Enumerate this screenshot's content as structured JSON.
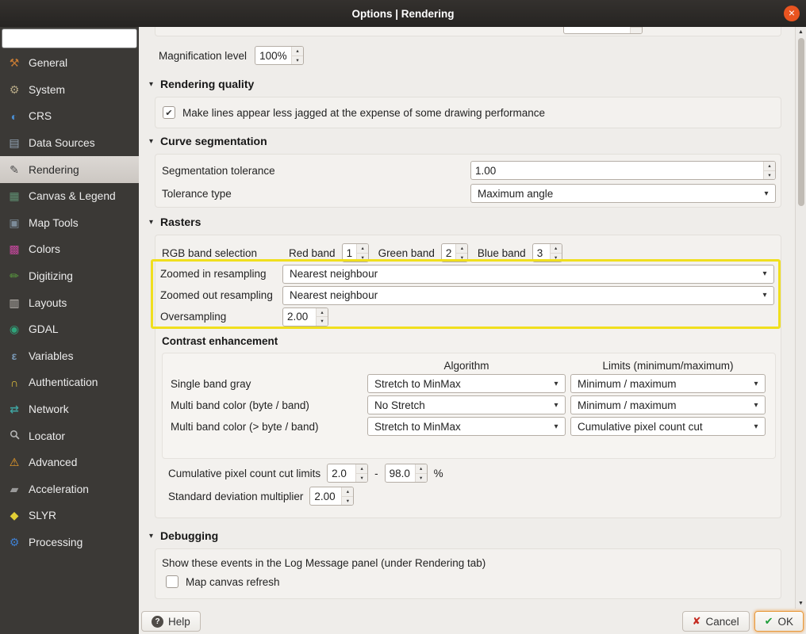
{
  "window": {
    "title": "Options | Rendering"
  },
  "icons": {
    "close": "×",
    "collapse": "▾",
    "combo_arrow": "▾",
    "spin_up": "▴",
    "spin_down": "▾",
    "check": "✔",
    "help": "?",
    "cancel_x": "✘",
    "ok_check": "✔",
    "scroll_up": "▲",
    "scroll_down": "▼"
  },
  "colors": {
    "titlebar_close": "#e95420",
    "highlight_border": "#f0df1e",
    "ok_focus_border": "#e89a3c",
    "cancel_icon": "#c42b20",
    "ok_icon": "#1f9d3a"
  },
  "sidebar": {
    "items": [
      {
        "label": "General",
        "icon": "wrench-hammer-icon",
        "glyph": "⚒",
        "color": "#c77b34"
      },
      {
        "label": "System",
        "icon": "gears-icon",
        "glyph": "⚙",
        "color": "#b3a684"
      },
      {
        "label": "CRS",
        "icon": "globe-icon",
        "glyph": "◐",
        "color": "#4a8fd3"
      },
      {
        "label": "Data Sources",
        "icon": "layers-icon",
        "glyph": "▤",
        "color": "#93a4b5"
      },
      {
        "label": "Rendering",
        "icon": "paintbrush-icon",
        "glyph": "✎",
        "color": "#4a4a4a",
        "selected": true
      },
      {
        "label": "Canvas & Legend",
        "icon": "canvas-icon",
        "glyph": "▦",
        "color": "#5f8f72"
      },
      {
        "label": "Map Tools",
        "icon": "map-tools-icon",
        "glyph": "▣",
        "color": "#7c8b99"
      },
      {
        "label": "Colors",
        "icon": "palette-icon",
        "glyph": "▩",
        "color": "#c4489c"
      },
      {
        "label": "Digitizing",
        "icon": "pencil-icon",
        "glyph": "✏",
        "color": "#5a9e3f"
      },
      {
        "label": "Layouts",
        "icon": "layout-icon",
        "glyph": "▥",
        "color": "#c2bdb8"
      },
      {
        "label": "GDAL",
        "icon": "gdal-globe-icon",
        "glyph": "◉",
        "color": "#2fa37a"
      },
      {
        "label": "Variables",
        "icon": "variables-icon",
        "glyph": "ε",
        "color": "#7a9ab8"
      },
      {
        "label": "Authentication",
        "icon": "lock-icon",
        "glyph": "∩",
        "color": "#e6c33c"
      },
      {
        "label": "Network",
        "icon": "network-icon",
        "glyph": "⇄",
        "color": "#3fa3a0"
      },
      {
        "label": "Locator",
        "icon": "magnifier-icon",
        "glyph": "",
        "color": "#b8b8b8"
      },
      {
        "label": "Advanced",
        "icon": "warning-icon",
        "glyph": "⚠",
        "color": "#f0a028"
      },
      {
        "label": "Acceleration",
        "icon": "chip-icon",
        "glyph": "▰",
        "color": "#9a9a9a"
      },
      {
        "label": "SLYR",
        "icon": "slyr-icon",
        "glyph": "◆",
        "color": "#e3cf35"
      },
      {
        "label": "Processing",
        "icon": "processing-gear-icon",
        "glyph": "⚙",
        "color": "#3f7fd0"
      }
    ]
  },
  "content": {
    "magnification": {
      "label": "Magnification level",
      "value": "100%"
    },
    "rendering_quality": {
      "title": "Rendering quality",
      "antialias_label": "Make lines appear less jagged at the expense of some drawing performance",
      "antialias_checked": true
    },
    "curve": {
      "title": "Curve segmentation",
      "tolerance_label": "Segmentation tolerance",
      "tolerance_value": "1.00",
      "type_label": "Tolerance type",
      "type_value": "Maximum angle"
    },
    "rasters": {
      "title": "Rasters",
      "rgb_label": "RGB band selection",
      "red_label": "Red band",
      "red_value": "1",
      "green_label": "Green band",
      "green_value": "2",
      "blue_label": "Blue band",
      "blue_value": "3",
      "zoomed_in_label": "Zoomed in resampling",
      "zoomed_in_value": "Nearest neighbour",
      "zoomed_out_label": "Zoomed out resampling",
      "zoomed_out_value": "Nearest neighbour",
      "oversampling_label": "Oversampling",
      "oversampling_value": "2.00"
    },
    "contrast": {
      "title": "Contrast enhancement",
      "col_algorithm": "Algorithm",
      "col_limits": "Limits (minimum/maximum)",
      "rows": [
        {
          "label": "Single band gray",
          "algorithm": "Stretch to MinMax",
          "limits": "Minimum / maximum"
        },
        {
          "label": "Multi band color (byte / band)",
          "algorithm": "No Stretch",
          "limits": "Minimum / maximum"
        },
        {
          "label": "Multi band color (> byte / band)",
          "algorithm": "Stretch to MinMax",
          "limits": "Cumulative pixel count cut"
        }
      ],
      "cum_label": "Cumulative pixel count cut limits",
      "cum_min": "2.0",
      "cum_dash": "-",
      "cum_max": "98.0",
      "cum_unit": "%",
      "std_label": "Standard deviation multiplier",
      "std_value": "2.00"
    },
    "debugging": {
      "title": "Debugging",
      "description": "Show these events in the Log Message panel (under Rendering tab)",
      "map_canvas_refresh_label": "Map canvas refresh",
      "map_canvas_refresh_checked": false
    }
  },
  "footer": {
    "help": "Help",
    "cancel": "Cancel",
    "ok": "OK"
  }
}
